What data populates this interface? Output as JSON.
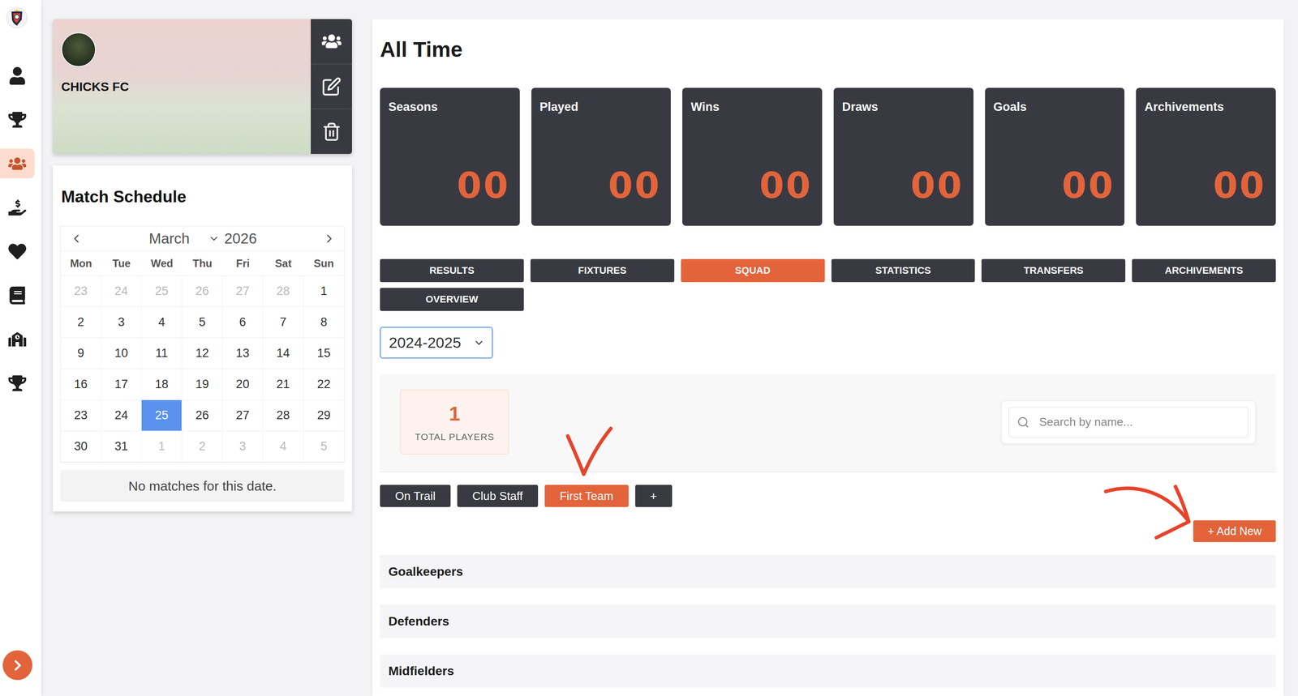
{
  "sidebar": {
    "items": [
      {
        "selected": false
      },
      {
        "selected": false
      },
      {
        "selected": true
      },
      {
        "selected": false
      },
      {
        "selected": false
      },
      {
        "selected": false
      },
      {
        "selected": false
      },
      {
        "selected": false
      }
    ]
  },
  "team": {
    "name": "CHICKS FC"
  },
  "schedule": {
    "title": "Match Schedule",
    "month": "March",
    "year": "2026",
    "weekdays": [
      "Mon",
      "Tue",
      "Wed",
      "Thu",
      "Fri",
      "Sat",
      "Sun"
    ],
    "weeks": [
      [
        {
          "day": "23",
          "muted": true,
          "selected": false
        },
        {
          "day": "24",
          "muted": true,
          "selected": false
        },
        {
          "day": "25",
          "muted": true,
          "selected": false
        },
        {
          "day": "26",
          "muted": true,
          "selected": false
        },
        {
          "day": "27",
          "muted": true,
          "selected": false
        },
        {
          "day": "28",
          "muted": true,
          "selected": false
        },
        {
          "day": "1",
          "muted": false,
          "selected": false
        }
      ],
      [
        {
          "day": "2",
          "muted": false,
          "selected": false
        },
        {
          "day": "3",
          "muted": false,
          "selected": false
        },
        {
          "day": "4",
          "muted": false,
          "selected": false
        },
        {
          "day": "5",
          "muted": false,
          "selected": false
        },
        {
          "day": "6",
          "muted": false,
          "selected": false
        },
        {
          "day": "7",
          "muted": false,
          "selected": false
        },
        {
          "day": "8",
          "muted": false,
          "selected": false
        }
      ],
      [
        {
          "day": "9",
          "muted": false,
          "selected": false
        },
        {
          "day": "10",
          "muted": false,
          "selected": false
        },
        {
          "day": "11",
          "muted": false,
          "selected": false
        },
        {
          "day": "12",
          "muted": false,
          "selected": false
        },
        {
          "day": "13",
          "muted": false,
          "selected": false
        },
        {
          "day": "14",
          "muted": false,
          "selected": false
        },
        {
          "day": "15",
          "muted": false,
          "selected": false
        }
      ],
      [
        {
          "day": "16",
          "muted": false,
          "selected": false
        },
        {
          "day": "17",
          "muted": false,
          "selected": false
        },
        {
          "day": "18",
          "muted": false,
          "selected": false
        },
        {
          "day": "19",
          "muted": false,
          "selected": false
        },
        {
          "day": "20",
          "muted": false,
          "selected": false
        },
        {
          "day": "21",
          "muted": false,
          "selected": false
        },
        {
          "day": "22",
          "muted": false,
          "selected": false
        }
      ],
      [
        {
          "day": "23",
          "muted": false,
          "selected": false
        },
        {
          "day": "24",
          "muted": false,
          "selected": false
        },
        {
          "day": "25",
          "muted": false,
          "selected": true
        },
        {
          "day": "26",
          "muted": false,
          "selected": false
        },
        {
          "day": "27",
          "muted": false,
          "selected": false
        },
        {
          "day": "28",
          "muted": false,
          "selected": false
        },
        {
          "day": "29",
          "muted": false,
          "selected": false
        }
      ],
      [
        {
          "day": "30",
          "muted": false,
          "selected": false
        },
        {
          "day": "31",
          "muted": false,
          "selected": false
        },
        {
          "day": "1",
          "muted": true,
          "selected": false
        },
        {
          "day": "2",
          "muted": true,
          "selected": false
        },
        {
          "day": "3",
          "muted": true,
          "selected": false
        },
        {
          "day": "4",
          "muted": true,
          "selected": false
        },
        {
          "day": "5",
          "muted": true,
          "selected": false
        }
      ]
    ],
    "empty_message": "No matches for this date."
  },
  "stats": {
    "title": "All Time",
    "cards": [
      {
        "label": "Seasons",
        "value": "00"
      },
      {
        "label": "Played",
        "value": "00"
      },
      {
        "label": "Wins",
        "value": "00"
      },
      {
        "label": "Draws",
        "value": "00"
      },
      {
        "label": "Goals",
        "value": "00"
      },
      {
        "label": "Archivements",
        "value": "00"
      }
    ]
  },
  "tabs": [
    {
      "label": "RESULTS",
      "selected": false
    },
    {
      "label": "FIXTURES",
      "selected": false
    },
    {
      "label": "SQUAD",
      "selected": true
    },
    {
      "label": "STATISTICS",
      "selected": false
    },
    {
      "label": "TRANSFERS",
      "selected": false
    },
    {
      "label": "ARCHIVEMENTS",
      "selected": false
    },
    {
      "label": "OVERVIEW",
      "selected": false
    }
  ],
  "season": {
    "value": "2024-2025"
  },
  "squad": {
    "total": "1",
    "total_label": "TOTAL PLAYERS",
    "search_placeholder": "Search by name...",
    "groups": [
      {
        "label": "On Trail",
        "selected": false
      },
      {
        "label": "Club Staff",
        "selected": false
      },
      {
        "label": "First Team",
        "selected": true
      },
      {
        "label": "+",
        "selected": false
      }
    ],
    "add_button": "+ Add New",
    "sections": [
      "Goalkeepers",
      "Defenders",
      "Midfielders"
    ]
  }
}
